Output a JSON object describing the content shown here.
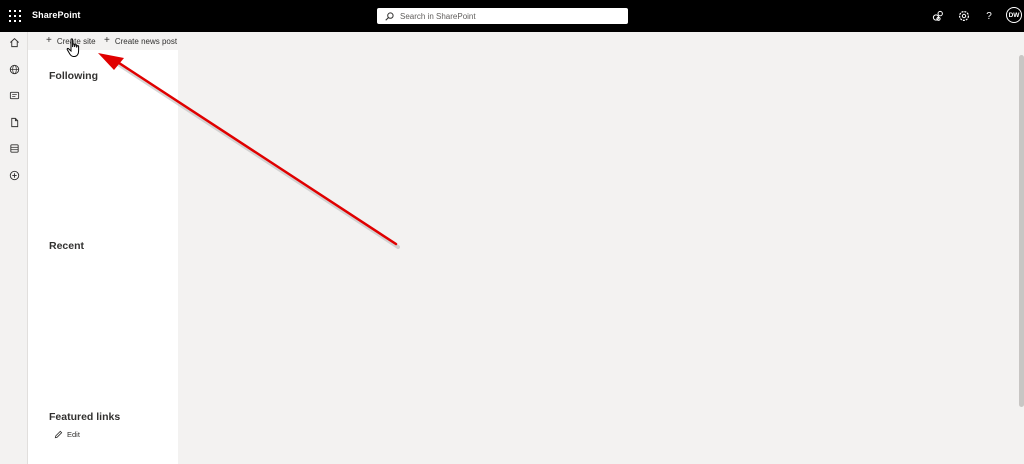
{
  "app": {
    "name": "SharePoint"
  },
  "search": {
    "placeholder": "Search in SharePoint"
  },
  "header": {
    "help_glyph": "?",
    "user_initials": "DW"
  },
  "commandbar": {
    "create_site": "Create site",
    "create_news_post": "Create news post"
  },
  "left_panel": {
    "following_title": "Following",
    "recent_title": "Recent",
    "featured_links_title": "Featured links",
    "edit_label": "Edit"
  },
  "left_rail": {
    "items": [
      "home-icon",
      "globe-icon",
      "news-icon",
      "file-icon",
      "lists-icon",
      "create-icon"
    ]
  },
  "colors": {
    "topbar": "#000000",
    "page_background": "#f3f2f1",
    "panel_background": "#ffffff",
    "annotation_arrow": "#e00000"
  }
}
